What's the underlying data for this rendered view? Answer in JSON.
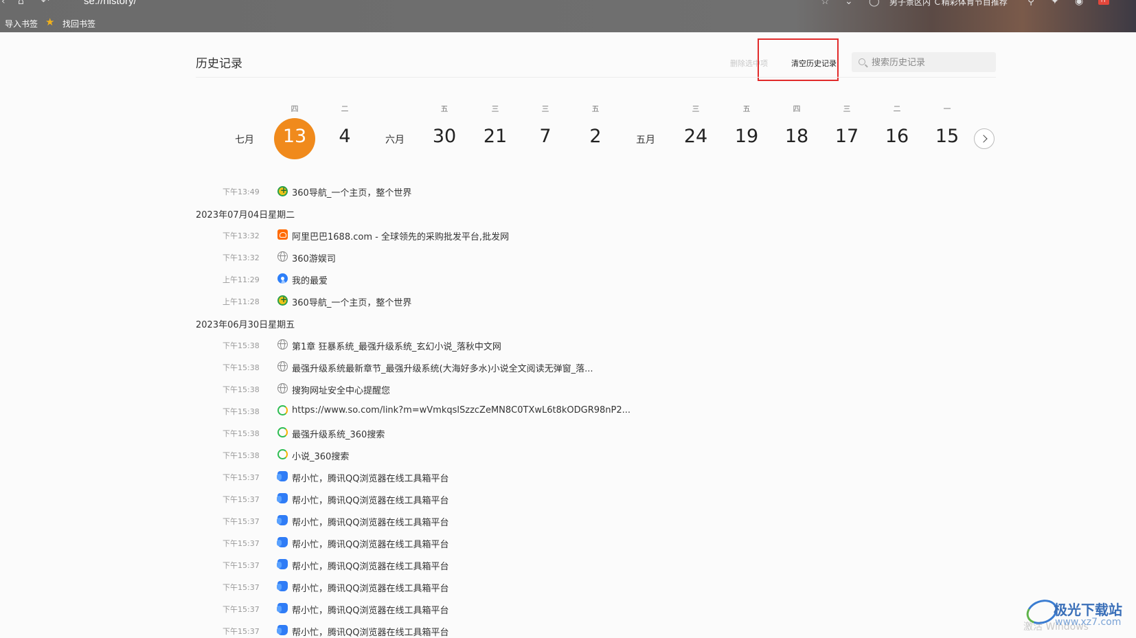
{
  "chrome": {
    "url": "se://history/",
    "addr_right_text": "男子景区内 Ｃ精彩体育节目推荐",
    "avatar_badge": "伴",
    "bookmarks": {
      "import_label": "导入书签",
      "recover_label": "找回书签"
    }
  },
  "header": {
    "title": "历史记录",
    "delete_selected_label": "删除选中项",
    "clear_history_label": "清空历史记录",
    "search_placeholder": "搜索历史记录"
  },
  "calendar": {
    "months": {
      "july": "七月",
      "june": "六月",
      "may": "五月"
    },
    "days": [
      {
        "weekday": "四",
        "day": "13",
        "selected": true
      },
      {
        "weekday": "二",
        "day": "4"
      },
      {
        "weekday": "五",
        "day": "30"
      },
      {
        "weekday": "三",
        "day": "21"
      },
      {
        "weekday": "三",
        "day": "7"
      },
      {
        "weekday": "五",
        "day": "2"
      },
      {
        "weekday": "三",
        "day": "24"
      },
      {
        "weekday": "五",
        "day": "19"
      },
      {
        "weekday": "四",
        "day": "18"
      },
      {
        "weekday": "三",
        "day": "17"
      },
      {
        "weekday": "二",
        "day": "16"
      },
      {
        "weekday": "一",
        "day": "15"
      }
    ],
    "accent_color": "#f08a1c"
  },
  "history": {
    "group_0": {
      "entries": [
        {
          "time": "下午13:49",
          "icon": "360-nav-icon",
          "title": "360导航_一个主页，整个世界"
        }
      ]
    },
    "group_1": {
      "date": "2023年07月04日星期二",
      "entries": [
        {
          "time": "下午13:32",
          "icon": "alibaba-icon",
          "title": "阿里巴巴1688.com - 全球领先的采购批发平台,批发网"
        },
        {
          "time": "下午13:32",
          "icon": "globe-icon",
          "title": "360游娱司"
        },
        {
          "time": "上午11:29",
          "icon": "swirl-icon",
          "title": "我的最爱"
        },
        {
          "time": "上午11:28",
          "icon": "360-nav-icon",
          "title": "360导航_一个主页，整个世界"
        }
      ]
    },
    "group_2": {
      "date": "2023年06月30日星期五",
      "entries": [
        {
          "time": "下午15:38",
          "icon": "globe-icon",
          "title": "第1章 狂暴系统_最强升级系统_玄幻小说_落秋中文网"
        },
        {
          "time": "下午15:38",
          "icon": "globe-icon",
          "title": "最强升级系统最新章节_最强升级系统(大海好多水)小说全文阅读无弹窗_落..."
        },
        {
          "time": "下午15:38",
          "icon": "globe-icon",
          "title": "搜狗网址安全中心提醒您"
        },
        {
          "time": "下午15:38",
          "icon": "360-search-icon",
          "title": "https://www.so.com/link?m=wVmkqslSzzcZeMN8C0TXwL6t8kODGR98nP2..."
        },
        {
          "time": "下午15:38",
          "icon": "360-search-icon",
          "title": "最强升级系统_360搜索"
        },
        {
          "time": "下午15:38",
          "icon": "360-search-icon",
          "title": "小说_360搜索"
        },
        {
          "time": "下午15:37",
          "icon": "qq-browser-icon",
          "title": "帮小忙，腾讯QQ浏览器在线工具箱平台"
        },
        {
          "time": "下午15:37",
          "icon": "qq-browser-icon",
          "title": "帮小忙，腾讯QQ浏览器在线工具箱平台"
        },
        {
          "time": "下午15:37",
          "icon": "qq-browser-icon",
          "title": "帮小忙，腾讯QQ浏览器在线工具箱平台"
        },
        {
          "time": "下午15:37",
          "icon": "qq-browser-icon",
          "title": "帮小忙，腾讯QQ浏览器在线工具箱平台"
        },
        {
          "time": "下午15:37",
          "icon": "qq-browser-icon",
          "title": "帮小忙，腾讯QQ浏览器在线工具箱平台"
        },
        {
          "time": "下午15:37",
          "icon": "qq-browser-icon",
          "title": "帮小忙，腾讯QQ浏览器在线工具箱平台"
        },
        {
          "time": "下午15:37",
          "icon": "qq-browser-icon",
          "title": "帮小忙，腾讯QQ浏览器在线工具箱平台"
        },
        {
          "time": "下午15:37",
          "icon": "qq-browser-icon",
          "title": "帮小忙，腾讯QQ浏览器在线工具箱平台"
        }
      ]
    }
  },
  "watermark": {
    "site_name": "极光下载站",
    "site_url": "www.xz7.com",
    "overlay_text": "激活 Windows"
  }
}
